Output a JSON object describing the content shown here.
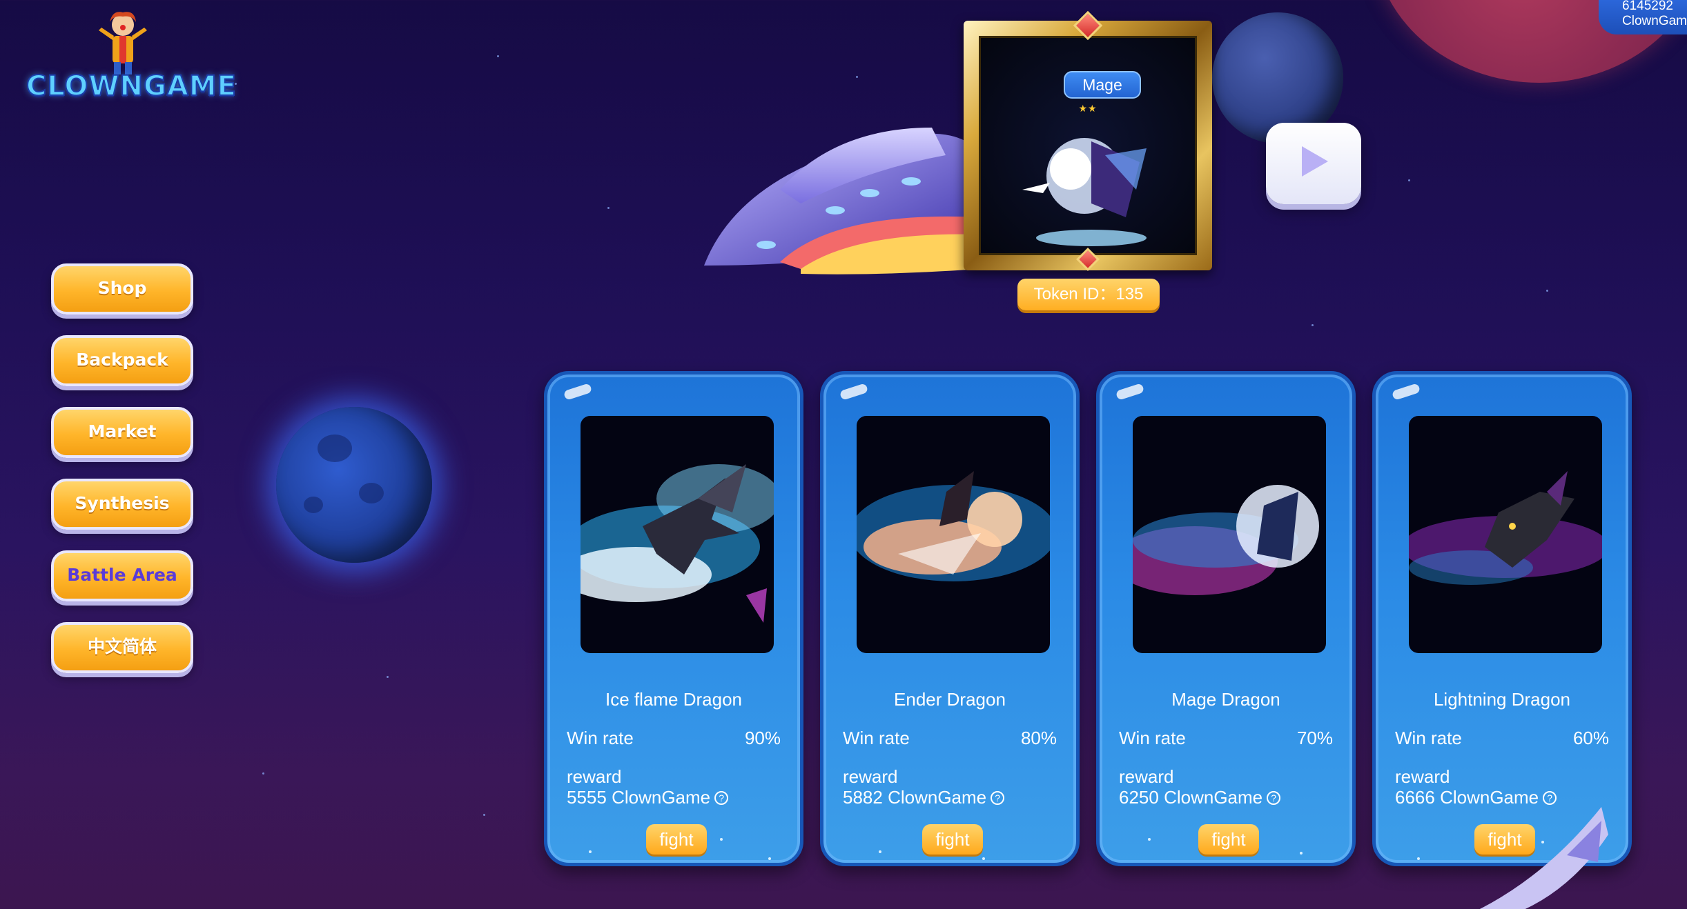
{
  "logo": {
    "text": "CLOWNGAME"
  },
  "menu": {
    "items": [
      {
        "label": "Shop",
        "active": false
      },
      {
        "label": "Backpack",
        "active": false
      },
      {
        "label": "Market",
        "active": false
      },
      {
        "label": "Synthesis",
        "active": false
      },
      {
        "label": "Battle Area",
        "active": true
      },
      {
        "label": "中文简体",
        "active": false
      }
    ]
  },
  "account": {
    "line1": "6145292",
    "line2": "ClownGame"
  },
  "featured": {
    "type": "Mage",
    "stars": "★★",
    "token_id": "Token ID：135"
  },
  "cards": [
    {
      "name": "Ice flame Dragon",
      "win_label": "Win rate",
      "win_rate": "90%",
      "reward_label": "reward",
      "reward": "5555 ClownGame",
      "button": "fight",
      "theme": "ice"
    },
    {
      "name": "Ender Dragon",
      "win_label": "Win rate",
      "win_rate": "80%",
      "reward_label": "reward",
      "reward": "5882 ClownGame",
      "button": "fight",
      "theme": "fire"
    },
    {
      "name": "Mage Dragon",
      "win_label": "Win rate",
      "win_rate": "70%",
      "reward_label": "reward",
      "reward": "6250 ClownGame",
      "button": "fight",
      "theme": "mage"
    },
    {
      "name": "Lightning Dragon",
      "win_label": "Win rate",
      "win_rate": "60%",
      "reward_label": "reward",
      "reward": "6666 ClownGame",
      "button": "fight",
      "theme": "lightning"
    }
  ],
  "colors": {
    "background": "#1e0f55",
    "button_gold": "#ffb52a",
    "card_blue": "#2b8be6",
    "active_text": "#5a3bd8"
  },
  "icons": [
    "clown-mascot-icon",
    "play-icon",
    "help-circle-icon",
    "ufo-icon",
    "planet-icon",
    "rocket-icon"
  ]
}
